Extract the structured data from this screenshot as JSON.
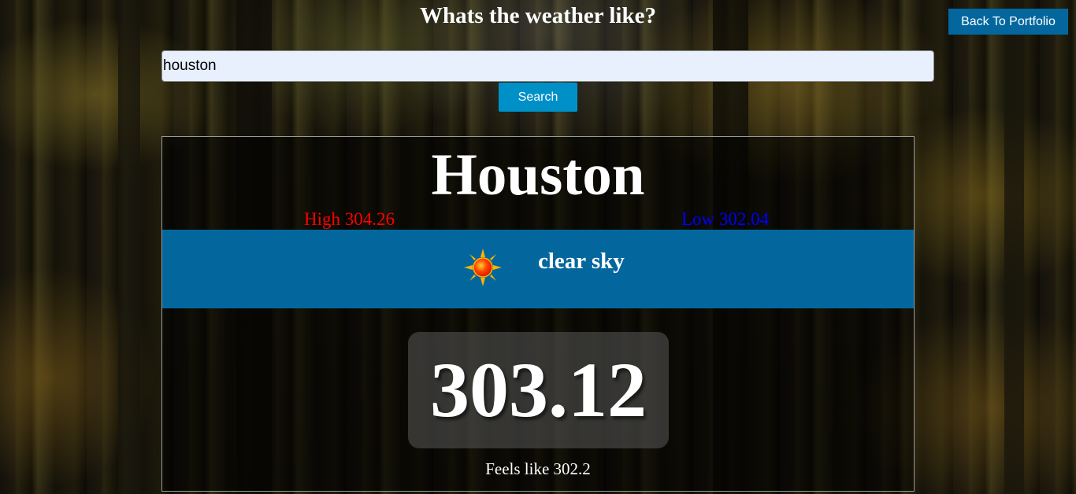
{
  "header": {
    "title": "Whats the weather like?",
    "back_button_label": "Back To Portfolio"
  },
  "search": {
    "value": "houston",
    "button_label": "Search"
  },
  "weather": {
    "city": "Houston",
    "high": "High 304.26",
    "low": "Low 302.04",
    "condition": "clear sky",
    "condition_icon": "sun-icon",
    "temperature": "303.12",
    "feels_like": "Feels like 302.2"
  },
  "colors": {
    "accent": "#03679e",
    "search_button": "#0090c8",
    "high": "#ff0000",
    "low": "#0000ff"
  }
}
